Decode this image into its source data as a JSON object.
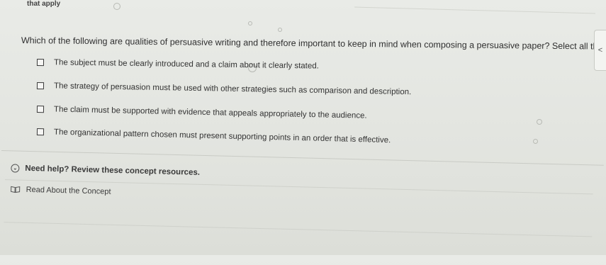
{
  "header": {
    "cut_text": "that apply"
  },
  "question": {
    "text": "Which of the following are qualities of persuasive writing and therefore important to keep in mind when composing a persuasive paper? Select all that apply."
  },
  "options": [
    {
      "label": "The subject must be clearly introduced and a claim about it clearly stated.",
      "checked": false
    },
    {
      "label": "The strategy of persuasion must be used with other strategies such as comparison and description.",
      "checked": false
    },
    {
      "label": "The claim must be supported with evidence that appeals appropriately to the audience.",
      "checked": false
    },
    {
      "label": "The organizational pattern chosen must present supporting points in an order that is effective.",
      "checked": false
    }
  ],
  "help": {
    "title": "Need help? Review these concept resources.",
    "link": "Read About the Concept"
  },
  "side_tab": {
    "glyph": "<"
  },
  "icons": {
    "help": "chevron-circle-icon",
    "link": "book-icon"
  }
}
